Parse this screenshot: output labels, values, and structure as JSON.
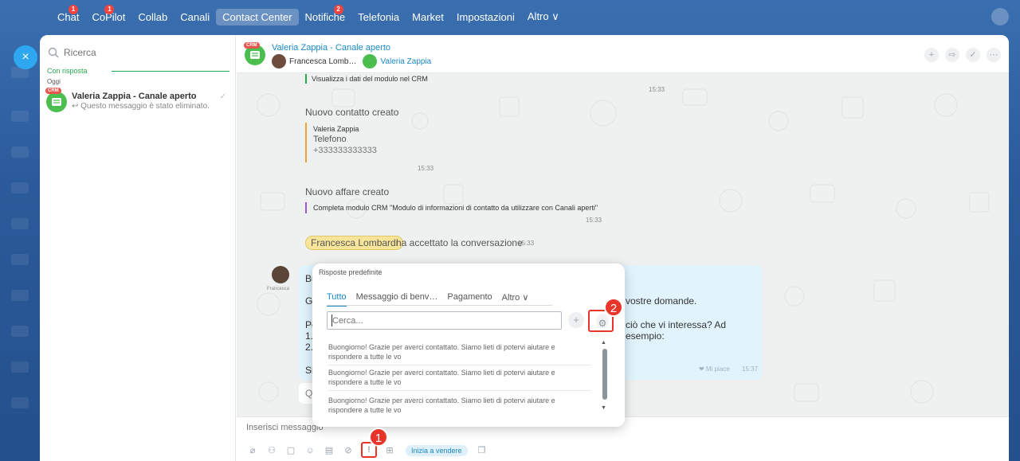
{
  "nav": {
    "items": [
      {
        "label": "Chat",
        "badge": "1"
      },
      {
        "label": "CoPilot",
        "badge": "1"
      },
      {
        "label": "Collab"
      },
      {
        "label": "Canali"
      },
      {
        "label": "Contact Center",
        "active": true
      },
      {
        "label": "Notifiche",
        "badge": "2"
      },
      {
        "label": "Telefonia"
      },
      {
        "label": "Market"
      },
      {
        "label": "Impostazioni"
      },
      {
        "label": "Altro ∨"
      }
    ]
  },
  "close_label": "×",
  "sidebar": {
    "search_placeholder": "Ricerca",
    "section_title": "Con risposta",
    "date_label": "Oggi",
    "chat": {
      "crm": "CRM",
      "title": "Valeria Zappia - Canale aperto",
      "preview": "↩ Questo messaggio è stato eliminato."
    }
  },
  "header": {
    "crm": "CRM",
    "title": "Valeria Zappia - Canale aperto",
    "user1": "Francesca Lomb…",
    "user2": "Valeria Zappia"
  },
  "messages": {
    "m1_text": "Visualizza i dati del modulo nel CRM",
    "m1_time": "15:33",
    "contact_title": "Nuovo contatto creato",
    "contact_name": "Valeria Zappia",
    "contact_field": "Telefono",
    "contact_value": "+333333333333",
    "contact_time": "15:33",
    "deal_title": "Nuovo affare creato",
    "deal_text": "Completa modulo CRM \"Modulo di informazioni di contatto da utilizzare con Canali aperti\"",
    "deal_time": "15:33",
    "accepted_name": "Francesca Lombardi",
    "accepted_text": "ha accettato la conversazione",
    "accepted_time": "15:33",
    "sender_name": "Francesca",
    "bubble_l1": "Bu",
    "bubble_l2": "G",
    "bubble_l2_end": "vostre domande.",
    "bubble_l3": "Pe",
    "bubble_l3_end": "ciò che vi interessa? Ad esempio:",
    "bubble_l4": "1.",
    "bubble_l5": "2.",
    "bubble_l6": "Si",
    "like": "❤ Mi piace",
    "bubble_time": "15:37",
    "chip": "Q"
  },
  "composer": {
    "placeholder": "Inserisci messaggio",
    "sell_label": "Inizia a vendere"
  },
  "popup": {
    "title": "Risposte predefinite",
    "tabs": [
      "Tutto",
      "Messaggio di benv…",
      "Pagamento",
      "Altro ∨"
    ],
    "search_placeholder": "Cerca...",
    "add": "+",
    "items": [
      "Buongiorno! Grazie per averci contattato. Siamo lieti di potervi aiutare e rispondere a tutte le vo",
      "Buongiorno! Grazie per averci contattato. Siamo lieti di potervi aiutare e rispondere a tutte le vo",
      "Buongiorno! Grazie per averci contattato. Siamo lieti di potervi aiutare e rispondere a tutte le vo"
    ]
  },
  "callouts": {
    "one": "1",
    "two": "2"
  }
}
